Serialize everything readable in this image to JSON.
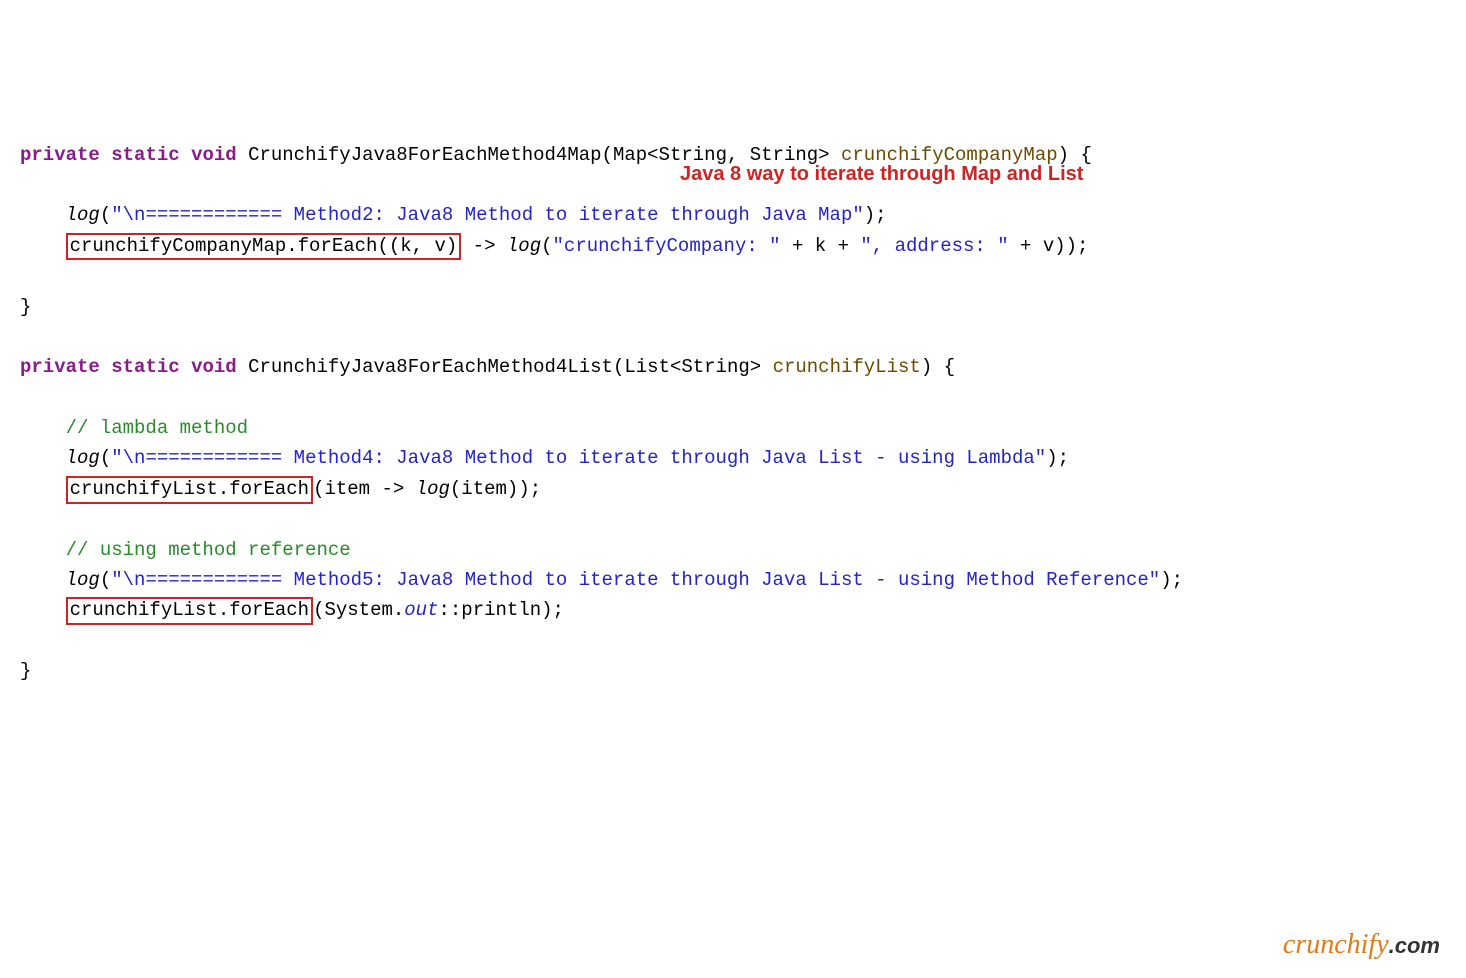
{
  "kw_private": "private",
  "kw_static": "static",
  "kw_void": "void",
  "m1_name": "CrunchifyJava8ForEachMethod4Map",
  "m1_params_open": "(Map<String, String> ",
  "m1_param_var": "crunchifyCompanyMap",
  "m1_params_close": ") {",
  "log_fn": "log",
  "m1_log1_str": "\"\\n============ Method2: Java8 Method to iterate through Java Map\"",
  "m1_line2_box": "crunchifyCompanyMap.forEach((k, v)",
  "m1_line2_arrow": " -> ",
  "m1_line2_logopen": "(",
  "m1_line2_str": "\"crunchifyCompany: \"",
  "m1_line2_mid1": " + k + ",
  "m1_line2_str2": "\", address: \"",
  "m1_line2_mid2": " + v));",
  "brace_close": "}",
  "annotation_text": "Java 8 way to iterate through Map and List",
  "m2_name": "CrunchifyJava8ForEachMethod4List",
  "m2_params_open": "(List<String> ",
  "m2_param_var": "crunchifyList",
  "m2_params_close": ") {",
  "cmt_lambda": "// lambda method",
  "m2_log1_str": "\"\\n============ Method4: Java8 Method to iterate through Java List - using Lambda\"",
  "m2_box1": "crunchifyList.forEach",
  "m2_after_box1_a": "(item -> ",
  "m2_after_box1_b": "(item));",
  "cmt_ref": "// using method reference",
  "m2_log2_str": "\"\\n============ Method5: Java8 Method to iterate through Java List - using Method Reference\"",
  "m2_box2": "crunchifyList.forEach",
  "m2_after_box2_a": "(System.",
  "m2_after_box2_out": "out",
  "m2_after_box2_b": "::println);",
  "watermark_brand": "crunchify",
  "watermark_dotcom": ".com"
}
